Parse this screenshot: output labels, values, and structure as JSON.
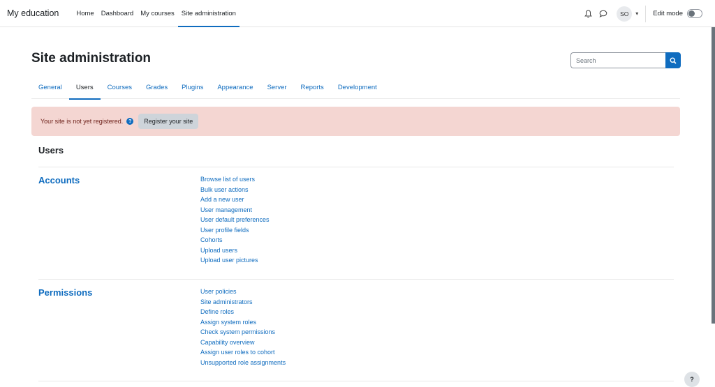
{
  "navbar": {
    "brand": "My education",
    "items": [
      {
        "label": "Home",
        "active": false
      },
      {
        "label": "Dashboard",
        "active": false
      },
      {
        "label": "My courses",
        "active": false
      },
      {
        "label": "Site administration",
        "active": true
      }
    ],
    "user_initials": "SO",
    "edit_mode_label": "Edit mode",
    "edit_mode_on": false,
    "icons": [
      "bell-icon",
      "chat-icon"
    ]
  },
  "header": {
    "title": "Site administration",
    "search_placeholder": "Search"
  },
  "tabs": [
    {
      "label": "General",
      "active": false
    },
    {
      "label": "Users",
      "active": true
    },
    {
      "label": "Courses",
      "active": false
    },
    {
      "label": "Grades",
      "active": false
    },
    {
      "label": "Plugins",
      "active": false
    },
    {
      "label": "Appearance",
      "active": false
    },
    {
      "label": "Server",
      "active": false
    },
    {
      "label": "Reports",
      "active": false
    },
    {
      "label": "Development",
      "active": false
    }
  ],
  "alert": {
    "message": "Your site is not yet registered.",
    "button": "Register your site"
  },
  "section": {
    "title": "Users",
    "categories": [
      {
        "title": "Accounts",
        "links": [
          "Browse list of users",
          "Bulk user actions",
          "Add a new user",
          "User management",
          "User default preferences",
          "User profile fields",
          "Cohorts",
          "Upload users",
          "Upload user pictures"
        ]
      },
      {
        "title": "Permissions",
        "links": [
          "User policies",
          "Site administrators",
          "Define roles",
          "Assign system roles",
          "Check system permissions",
          "Capability overview",
          "Assign user roles to cohort",
          "Unsupported role assignments"
        ]
      }
    ]
  },
  "help_button": "?",
  "colors": {
    "primary": "#0f6cbf",
    "alert_bg": "#f4d6d2",
    "alert_text": "#6e211a"
  }
}
